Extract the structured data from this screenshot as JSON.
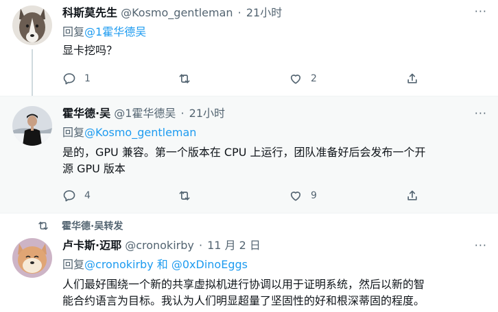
{
  "tweets": [
    {
      "name": "科斯莫先生",
      "handle": "@Kosmo_gentleman",
      "dot": "·",
      "time": "21小时",
      "reply_prefix": "回复",
      "reply_to": "@1霍华德吴",
      "text": "显卡挖吗？",
      "replies": "1",
      "retweets": "",
      "likes": "2",
      "avatar_icon": "husky-dog-avatar"
    },
    {
      "name": "霍华德·吴",
      "handle": "@1霍华德吴",
      "dot": "·",
      "time": "21小时",
      "reply_prefix": "回复",
      "reply_to": "@Kosmo_gentleman",
      "text_line1": "是的，GPU 兼容。第一个版本在 CPU 上运行，团队准备好后会发布一个开",
      "text_line2": "源 GPU 版本",
      "replies": "4",
      "retweets": "",
      "likes": "9",
      "avatar_icon": "person-snow-avatar"
    },
    {
      "retweeted_by": "霍华德·吴转发",
      "name": "卢卡斯·迈耶",
      "handle": "@cronokirby",
      "dot": "·",
      "time": "11 月 2 日",
      "reply_prefix": "回复",
      "reply_to_1": "@cronokirby",
      "reply_and": " 和 ",
      "reply_to_2": "@0xDinoEggs",
      "text_line1": "人们最好围绕一个新的共享虚拟机进行协调以用于证明系统，然后以新的智",
      "text_line2": "能合约语言为目标。我认为人们明显超量了坚固性的好和根深蒂固的程度。",
      "avatar_icon": "shiba-dog-avatar"
    }
  ],
  "more_label": "···",
  "colors": {
    "link": "#1d9bf0",
    "muted": "#536471",
    "text": "#0f1419",
    "highlight_bg": "#f7f9f9"
  }
}
